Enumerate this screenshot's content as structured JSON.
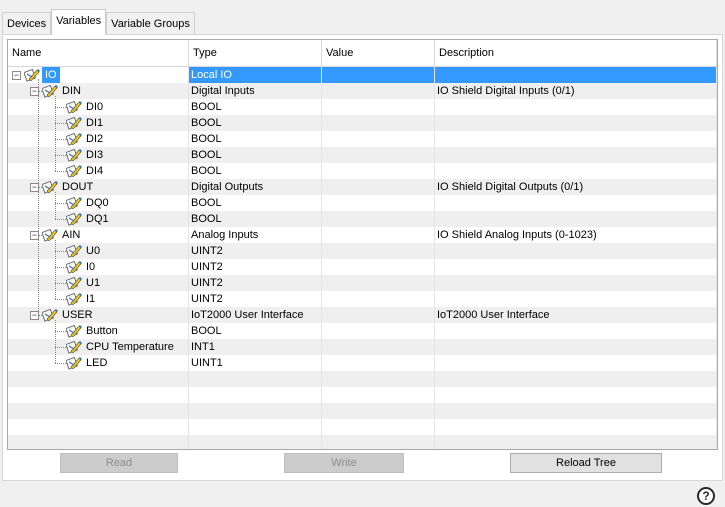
{
  "tabs": [
    {
      "label": "Devices",
      "active": false
    },
    {
      "label": "Variables",
      "active": true
    },
    {
      "label": "Variable Groups",
      "active": false
    }
  ],
  "grid": {
    "columns": [
      "Name",
      "Type",
      "Value",
      "Description"
    ],
    "rows": [
      {
        "level": 0,
        "name": "IO",
        "type": "Local IO",
        "value": "",
        "description": "",
        "expander": "−",
        "selected": true
      },
      {
        "level": 1,
        "name": "DIN",
        "type": "Digital Inputs",
        "value": "",
        "description": "IO Shield Digital Inputs (0/1)",
        "expander": "−"
      },
      {
        "level": 2,
        "name": "DI0",
        "type": "BOOL",
        "value": "",
        "description": ""
      },
      {
        "level": 2,
        "name": "DI1",
        "type": "BOOL",
        "value": "",
        "description": ""
      },
      {
        "level": 2,
        "name": "DI2",
        "type": "BOOL",
        "value": "",
        "description": ""
      },
      {
        "level": 2,
        "name": "DI3",
        "type": "BOOL",
        "value": "",
        "description": ""
      },
      {
        "level": 2,
        "name": "DI4",
        "type": "BOOL",
        "value": "",
        "description": ""
      },
      {
        "level": 1,
        "name": "DOUT",
        "type": "Digital Outputs",
        "value": "",
        "description": "IO Shield Digital Outputs (0/1)",
        "expander": "−"
      },
      {
        "level": 2,
        "name": "DQ0",
        "type": "BOOL",
        "value": "",
        "description": ""
      },
      {
        "level": 2,
        "name": "DQ1",
        "type": "BOOL",
        "value": "",
        "description": ""
      },
      {
        "level": 1,
        "name": "AIN",
        "type": "Analog Inputs",
        "value": "",
        "description": "IO Shield Analog Inputs (0-1023)",
        "expander": "−"
      },
      {
        "level": 2,
        "name": "U0",
        "type": "UINT2",
        "value": "",
        "description": ""
      },
      {
        "level": 2,
        "name": "I0",
        "type": "UINT2",
        "value": "",
        "description": ""
      },
      {
        "level": 2,
        "name": "U1",
        "type": "UINT2",
        "value": "",
        "description": ""
      },
      {
        "level": 2,
        "name": "I1",
        "type": "UINT2",
        "value": "",
        "description": ""
      },
      {
        "level": 1,
        "name": "USER",
        "type": "IoT2000 User Interface",
        "value": "",
        "description": "IoT2000 User Interface",
        "expander": "−"
      },
      {
        "level": 2,
        "name": "Button",
        "type": "BOOL",
        "value": "",
        "description": ""
      },
      {
        "level": 2,
        "name": "CPU Temperature",
        "type": "INT1",
        "value": "",
        "description": ""
      },
      {
        "level": 2,
        "name": "LED",
        "type": "UINT1",
        "value": "",
        "description": ""
      }
    ],
    "empty_rows": 5
  },
  "buttons": {
    "read": "Read",
    "write": "Write",
    "reload": "Reload Tree"
  },
  "help_label": "?",
  "colors": {
    "selection": "#3399ff",
    "icon_blue": "#2a6fd6",
    "icon_yellow": "#e2c13a"
  }
}
